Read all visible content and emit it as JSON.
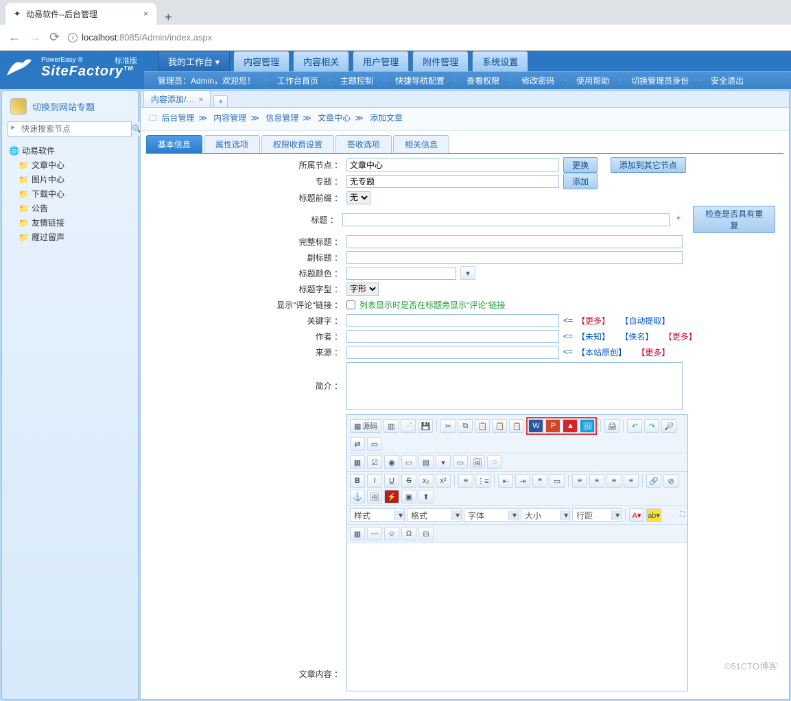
{
  "browser": {
    "tab_title": "动易软件--后台管理",
    "url_host": "localhost",
    "url_rest": ":8085/Admin/index.aspx"
  },
  "logo": {
    "small": "PowerEasy ®",
    "main": "SiteFactory",
    "tm": "TM",
    "badge": "标准版"
  },
  "main_menu": [
    "我的工作台 ▾",
    "内容管理",
    "内容相关",
    "用户管理",
    "附件管理",
    "系统设置"
  ],
  "sub_menu": {
    "greeting": "管理员：Admin，欢迎您！",
    "items": [
      "工作台首页",
      "主题控制",
      "快捷导航配置",
      "查看权限",
      "修改密码",
      "使用帮助",
      "切换管理员身份",
      "安全退出"
    ]
  },
  "sidebar": {
    "switch": "切换到网站专题",
    "search_placeholder": "快速搜索节点",
    "root": "动易软件",
    "nodes": [
      "文章中心",
      "图片中心",
      "下载中心",
      "公告",
      "友情链接",
      "雁过留声"
    ]
  },
  "doc_tab": "内容添加/…",
  "crumb": [
    "后台管理",
    "内容管理",
    "信息管理",
    "文章中心",
    "添加文章"
  ],
  "section_tabs": [
    "基本信息",
    "属性选项",
    "权限收费设置",
    "签收选项",
    "相关信息"
  ],
  "form": {
    "node_label": "所属节点  ：",
    "node_value": "文章中心",
    "change": "更换",
    "add_other": "添加到其它节点",
    "topic_label": "专题  ：",
    "topic_value": "无专题",
    "add": "添加",
    "prefix_label": "标题前缀  ：",
    "prefix_opt": "无",
    "title_label": "标题  ：",
    "check": "检查是否具有重复",
    "full_label": "完整标题  ：",
    "sub_label": "副标题  ：",
    "color_label": "标题颜色  ：",
    "font_label": "标题字型  ：",
    "font_opt": "字形",
    "show_label": "显示\"评论\"链接  ：",
    "show_hint": "列表显示时是否在标题旁显示\"评论\"链接",
    "kw_label": "关键字  ：",
    "kw_more": "【更多】",
    "kw_auto": "【自动提取】",
    "author_label": "作者  ：",
    "auth_unknown": "【未知】",
    "auth_anon": "【佚名】",
    "auth_more": "【更多】",
    "source_label": "来源  ：",
    "src_orig": "【本站原创】",
    "src_more": "【更多】",
    "intro_label": "简介  ：",
    "content_label": "文章内容  ："
  },
  "editor": {
    "source": "源码",
    "style": "样式",
    "format": "格式",
    "font": "字体",
    "size": "大小",
    "lineheight": "行距",
    "bold": "B",
    "italic": "I",
    "underline": "U",
    "strike": "S"
  },
  "watermark": "©51CTO博客"
}
